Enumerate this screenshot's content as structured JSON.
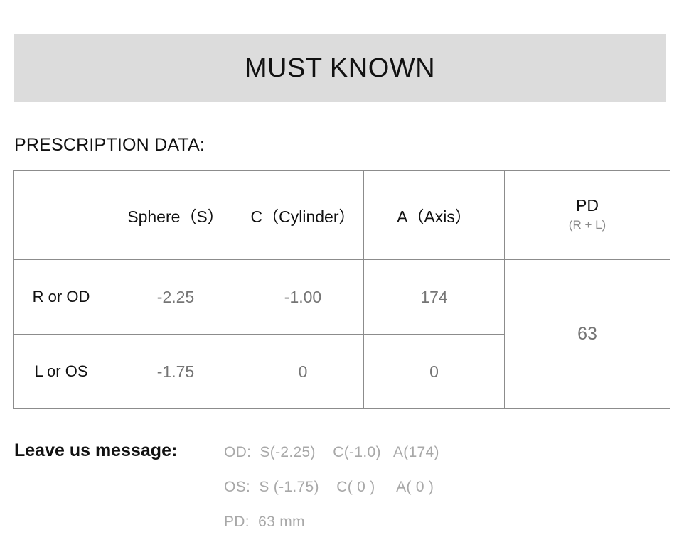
{
  "banner": {
    "title": "MUST KNOWN"
  },
  "section": {
    "label": "PRESCRIPTION DATA:"
  },
  "table": {
    "headers": {
      "corner": "",
      "sphere": "Sphere（S）",
      "cylinder": "C（Cylinder）",
      "axis": "A（Axis）",
      "pd_main": "PD",
      "pd_sub": "(R + L)"
    },
    "rows": [
      {
        "label": "R or OD",
        "sphere": "-2.25",
        "cylinder": "-1.00",
        "axis": "174"
      },
      {
        "label": "L or OS",
        "sphere": "-1.75",
        "cylinder": "0",
        "axis": "0"
      }
    ],
    "pd_value": "63"
  },
  "message": {
    "title": "Leave us message:",
    "lines": [
      "OD:  S(-2.25)    C(-1.0)   A(174)",
      "OS:  S (-1.75)    C( 0 )     A( 0 )",
      "PD:  63 mm"
    ]
  },
  "colors": {
    "banner_background": "#dcdcdc",
    "table_border": "#8c8c8c",
    "value_text": "#757575",
    "muted_text": "#a8a8a8",
    "primary_text": "#111111"
  }
}
